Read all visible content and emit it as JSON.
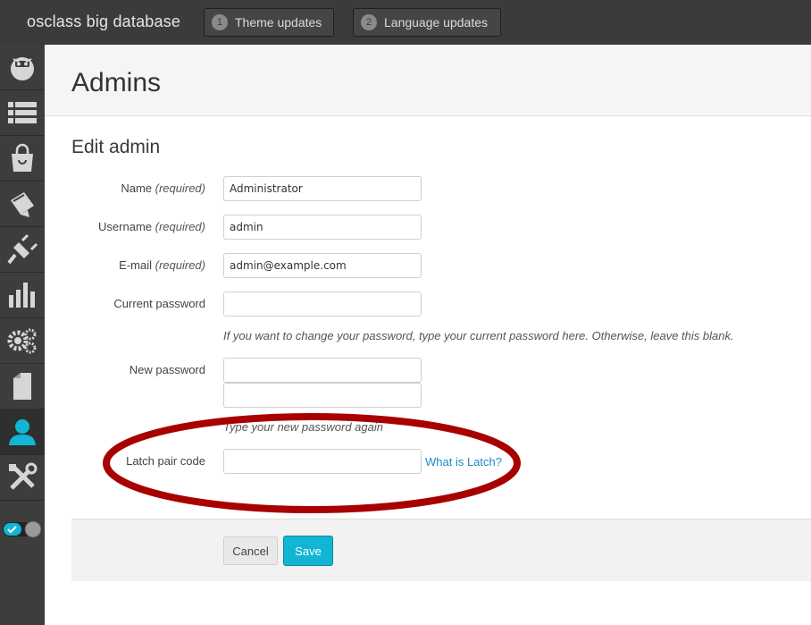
{
  "header": {
    "site_title": "osclass big database",
    "theme_updates": {
      "count": "1",
      "label": "Theme updates"
    },
    "language_updates": {
      "count": "2",
      "label": "Language updates"
    }
  },
  "sidebar": {
    "items": [
      {
        "icon": "dashboard-icon"
      },
      {
        "icon": "listings-icon"
      },
      {
        "icon": "market-icon"
      },
      {
        "icon": "appearance-icon"
      },
      {
        "icon": "plugins-icon"
      },
      {
        "icon": "stats-icon"
      },
      {
        "icon": "settings-icon"
      },
      {
        "icon": "pages-icon"
      },
      {
        "icon": "users-icon",
        "active": true
      },
      {
        "icon": "tools-icon"
      }
    ],
    "toggle": "mode-toggle"
  },
  "page": {
    "title": "Admins"
  },
  "form": {
    "section_title": "Edit admin",
    "name": {
      "label": "Name",
      "required": "(required)",
      "value": "Administrator"
    },
    "username": {
      "label": "Username",
      "required": "(required)",
      "value": "admin"
    },
    "email": {
      "label": "E-mail",
      "required": "(required)",
      "value": "admin@example.com"
    },
    "current_password": {
      "label": "Current password",
      "value": "",
      "help": "If you want to change your password, type your current password here. Otherwise, leave this blank."
    },
    "new_password": {
      "label": "New password",
      "value": "",
      "confirm_value": "",
      "help": "Type your new password again"
    },
    "latch": {
      "label": "Latch pair code",
      "value": "",
      "link": "What is Latch?"
    }
  },
  "actions": {
    "cancel": "Cancel",
    "save": "Save"
  },
  "colors": {
    "accent": "#12b6d4",
    "link": "#1a8bc8",
    "highlight": "#a80000",
    "sidebar": "#3d3d3d",
    "topbar": "#3b3b3b"
  }
}
